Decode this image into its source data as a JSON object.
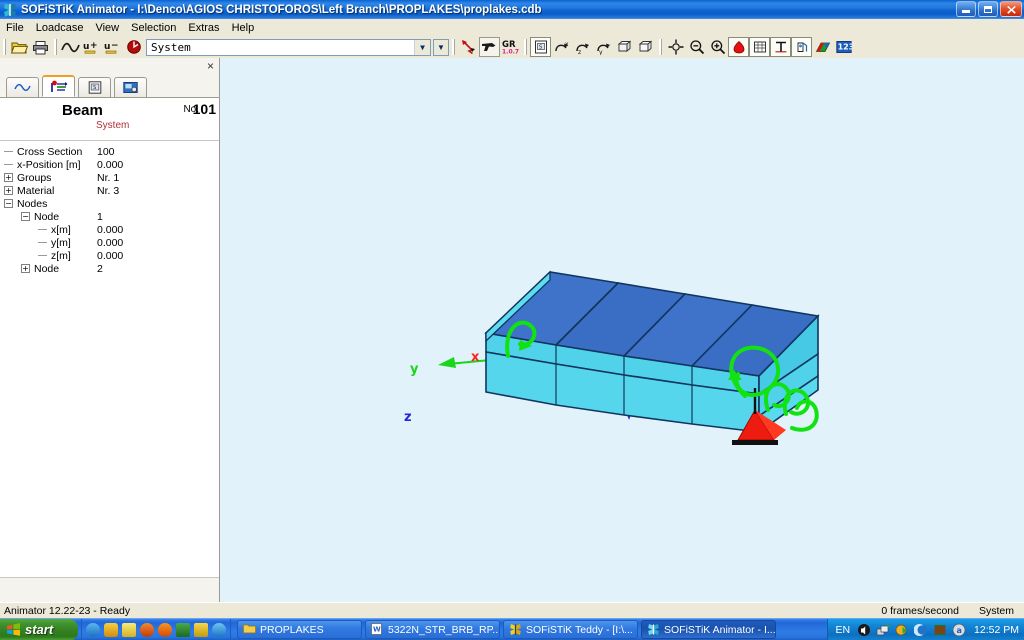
{
  "window": {
    "title": "SOFiSTiK Animator - I:\\Denco\\AGIOS CHRISTOFOROS\\Left Branch\\PROPLAKES\\proplakes.cdb",
    "app_icon": "sofistik-butterfly-icon",
    "minimize_label": "Minimize",
    "maximize_label": "Restore",
    "close_label": "Close"
  },
  "menu": {
    "items": [
      {
        "label": "File"
      },
      {
        "label": "Loadcase"
      },
      {
        "label": "View"
      },
      {
        "label": "Selection"
      },
      {
        "label": "Extras"
      },
      {
        "label": "Help"
      }
    ]
  },
  "toolbar": {
    "groups": [
      {
        "buttons": [
          {
            "name": "open-file-button",
            "icon": "open-folder-icon",
            "label": "Open"
          },
          {
            "name": "print-button",
            "icon": "printer-icon",
            "label": "Print"
          }
        ]
      },
      {
        "buttons": [
          {
            "name": "animate-button",
            "icon": "wave-icon",
            "label": "Animate"
          },
          {
            "name": "scale-up-button",
            "icon": "u-plus-icon",
            "label": "Increase deformation"
          },
          {
            "name": "scale-down-button",
            "icon": "u-minus-icon",
            "label": "Decrease deformation"
          },
          {
            "name": "loadcase-button",
            "icon": "red-circle-icon",
            "label": "Loadcase"
          }
        ]
      }
    ],
    "loadcase_combo": {
      "value": "System",
      "placeholder": "System"
    },
    "second_combo": {
      "value": ""
    },
    "right_buttons": [
      {
        "name": "pointer-select-button",
        "icon": "red-arrow-pointer-icon",
        "label": "Select"
      },
      {
        "name": "pick-tool-button",
        "icon": "pick-gun-icon",
        "label": "Pick",
        "pressed": true
      },
      {
        "name": "gr-button",
        "icon": "gr-icon",
        "label": "GR 1.0.7"
      },
      {
        "name": "properties-button",
        "icon": "property-box-icon",
        "label": "Properties"
      },
      {
        "name": "rotate-x-button",
        "icon": "rotate-x-icon",
        "label": "Rotate X"
      },
      {
        "name": "rotate-z-button",
        "icon": "rotate-z-icon",
        "label": "Rotate Z"
      },
      {
        "name": "rotate-y-button",
        "icon": "rotate-y-icon",
        "label": "Rotate Y"
      },
      {
        "name": "view-box-button",
        "icon": "box-view-icon",
        "label": "Box view"
      },
      {
        "name": "view-box2-button",
        "icon": "box-view-2-icon",
        "label": "Box view 2"
      },
      {
        "name": "pan-button",
        "icon": "pan-move-icon",
        "label": "Pan"
      },
      {
        "name": "zoom-out-button",
        "icon": "zoom-out-icon",
        "label": "Zoom out"
      },
      {
        "name": "zoom-in-button",
        "icon": "zoom-in-icon",
        "label": "Zoom in"
      },
      {
        "name": "color-fill-button",
        "icon": "red-fill-icon",
        "label": "Colors",
        "framed": true
      },
      {
        "name": "grid-button",
        "icon": "grid-icon",
        "label": "Grid",
        "framed": true
      },
      {
        "name": "text-button",
        "icon": "text-tool-icon",
        "label": "Text",
        "framed": true
      },
      {
        "name": "light-button",
        "icon": "light-icon",
        "label": "Lighting",
        "framed": true
      },
      {
        "name": "legend-button",
        "icon": "legend-flag-icon",
        "label": "Legend"
      },
      {
        "name": "numbers-button",
        "icon": "numbers-123-icon",
        "label": "Numbering"
      }
    ]
  },
  "panel": {
    "close_label": "×",
    "tabs": [
      {
        "name": "tab-results",
        "icon": "wave-curve-icon",
        "label": "Results",
        "active": false
      },
      {
        "name": "tab-properties",
        "icon": "beam-node-icon",
        "label": "Properties",
        "active": true
      },
      {
        "name": "tab-report",
        "icon": "report-icon",
        "label": "Report",
        "active": false
      },
      {
        "name": "tab-export",
        "icon": "export-image-icon",
        "label": "Export",
        "active": false
      }
    ],
    "header": {
      "title": "Beam",
      "subtitle": "System",
      "no_label": "No.",
      "no_value": "101"
    },
    "tree": [
      {
        "indent": 0,
        "toggle": "none",
        "label": "Cross Section",
        "value": "100"
      },
      {
        "indent": 0,
        "toggle": "none",
        "label": "x-Position [m]",
        "value": "0.000"
      },
      {
        "indent": 0,
        "toggle": "plus",
        "label": "Groups",
        "value": "Nr. 1"
      },
      {
        "indent": 0,
        "toggle": "plus",
        "label": "Material",
        "value": "Nr. 3"
      },
      {
        "indent": 0,
        "toggle": "minus",
        "label": "Nodes",
        "value": ""
      },
      {
        "indent": 1,
        "toggle": "minus",
        "label": "Node",
        "value": "1"
      },
      {
        "indent": 2,
        "toggle": "none",
        "label": "x[m]",
        "value": "0.000"
      },
      {
        "indent": 2,
        "toggle": "none",
        "label": "y[m]",
        "value": "0.000"
      },
      {
        "indent": 2,
        "toggle": "none",
        "label": "z[m]",
        "value": "0.000"
      },
      {
        "indent": 1,
        "toggle": "plus",
        "label": "Node",
        "value": "2"
      }
    ]
  },
  "viewport": {
    "background_color": "#e2f2fb",
    "axes": [
      {
        "name": "axis-x",
        "label": "x",
        "color": "#ff2020"
      },
      {
        "name": "axis-y",
        "label": "y",
        "color": "#18d618"
      },
      {
        "name": "axis-z",
        "label": "z",
        "color": "#2020e8"
      }
    ],
    "model": {
      "name": "beam-slab-model",
      "top_face_color": "#3a6dc4",
      "side_face_color": "#4fd2ea",
      "edge_color": "#10385f",
      "segments": 4,
      "support_color": "#ee1b10",
      "rotation_arrow_color": "#12e212"
    }
  },
  "statusbar": {
    "message": "Animator 12.22-23 - Ready",
    "fps": "0 frames/second",
    "loadcase": "System"
  },
  "taskbar": {
    "start_label": "start",
    "start_icon": "windows-flag-icon",
    "quick_launch": [
      {
        "name": "ql-icon-explorer",
        "icon": "blue-e-icon",
        "color": "#2a7fd4"
      },
      {
        "name": "ql-icon-media",
        "icon": "media-player-icon",
        "color": "#e8a41a"
      },
      {
        "name": "ql-icon-notes",
        "icon": "notes-icon",
        "color": "#e8d44a"
      },
      {
        "name": "ql-icon-desktop",
        "icon": "show-desktop-icon",
        "color": "#e05a1a"
      },
      {
        "name": "ql-icon-firefox",
        "icon": "firefox-icon",
        "color": "#f06a10"
      },
      {
        "name": "ql-icon-books",
        "icon": "library-icon",
        "color": "#2a8a3a"
      },
      {
        "name": "ql-icon-sofistik",
        "icon": "sofistik-butterfly-icon",
        "color": "#e8c020"
      },
      {
        "name": "ql-icon-moon",
        "icon": "moon-icon",
        "color": "#3a9fe0"
      }
    ],
    "tasks": [
      {
        "name": "task-proplakes",
        "label": "PROPLAKES",
        "icon": "folder-icon",
        "active": false
      },
      {
        "name": "task-word-doc",
        "label": "5322N_STR_BRB_RP...",
        "icon": "word-doc-icon",
        "active": false
      },
      {
        "name": "task-teddy",
        "label": "SOFiSTiK Teddy - [I:\\...",
        "icon": "sofistik-butterfly-icon",
        "active": false
      },
      {
        "name": "task-animator",
        "label": "SOFiSTiK Animator - I...",
        "icon": "sofistik-butterfly-icon",
        "active": true
      }
    ],
    "tray": {
      "language": "EN",
      "icons": [
        {
          "name": "tray-volume-icon",
          "icon": "volume-icon"
        },
        {
          "name": "tray-network-icon",
          "icon": "network-icon"
        },
        {
          "name": "tray-updates-icon",
          "icon": "updates-icon"
        },
        {
          "name": "tray-moon-icon",
          "icon": "moon-icon"
        },
        {
          "name": "tray-bars-icon",
          "icon": "bars-icon"
        },
        {
          "name": "tray-security-icon",
          "icon": "security-icon"
        }
      ],
      "time": "12:52 PM"
    }
  }
}
